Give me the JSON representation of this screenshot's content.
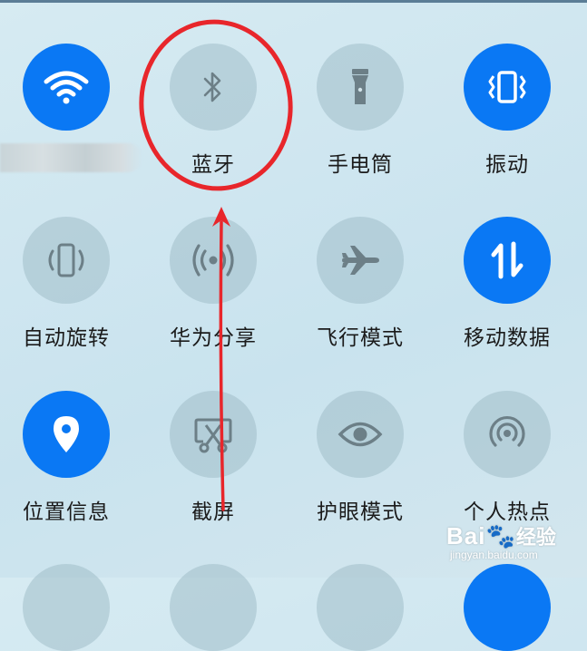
{
  "tiles": [
    {
      "id": "wifi",
      "label": "",
      "on": true,
      "icon": "wifi-icon"
    },
    {
      "id": "bluetooth",
      "label": "蓝牙",
      "on": false,
      "icon": "bluetooth-icon"
    },
    {
      "id": "flashlight",
      "label": "手电筒",
      "on": false,
      "icon": "flashlight-icon"
    },
    {
      "id": "vibrate",
      "label": "振动",
      "on": true,
      "icon": "vibrate-icon"
    },
    {
      "id": "autorotate",
      "label": "自动旋转",
      "on": false,
      "icon": "auto-rotate-icon"
    },
    {
      "id": "huaweishare",
      "label": "华为分享",
      "on": false,
      "icon": "share-icon"
    },
    {
      "id": "airplane",
      "label": "飞行模式",
      "on": false,
      "icon": "airplane-icon"
    },
    {
      "id": "mobiledata",
      "label": "移动数据",
      "on": true,
      "icon": "mobile-data-icon"
    },
    {
      "id": "location",
      "label": "位置信息",
      "on": true,
      "icon": "location-icon"
    },
    {
      "id": "screenshot",
      "label": "截屏",
      "on": false,
      "icon": "screenshot-icon"
    },
    {
      "id": "eyecomfort",
      "label": "护眼模式",
      "on": false,
      "icon": "eye-icon"
    },
    {
      "id": "hotspot",
      "label": "个人热点",
      "on": false,
      "icon": "hotspot-icon"
    }
  ],
  "colors": {
    "active": "#0a78f4",
    "inactive_icon": "#6c7f87",
    "annotation": "#e8262b"
  },
  "watermark": {
    "brand_a": "Bai",
    "brand_b": "经验",
    "url": "jingyan.baidu.com"
  }
}
